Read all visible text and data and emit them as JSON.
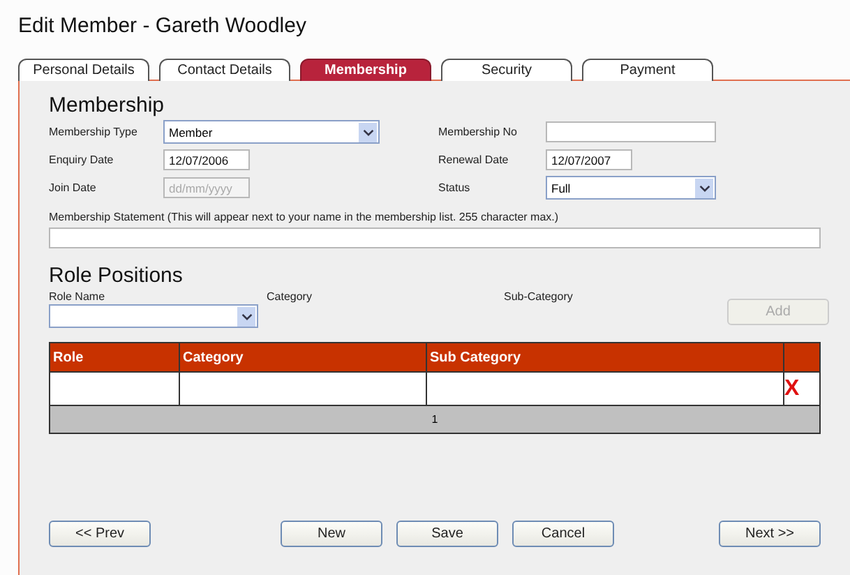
{
  "title": "Edit Member - Gareth Woodley",
  "tabs": [
    {
      "label": "Personal Details",
      "selected": false
    },
    {
      "label": "Contact Details",
      "selected": false
    },
    {
      "label": "Membership",
      "selected": true
    },
    {
      "label": "Security",
      "selected": false
    },
    {
      "label": "Payment",
      "selected": false
    }
  ],
  "membership": {
    "heading": "Membership",
    "membership_type": {
      "label": "Membership Type",
      "value": "Member"
    },
    "membership_no": {
      "label": "Membership No"
    },
    "enquiry_date": {
      "label": "Enquiry Date",
      "value": "12/07/2006"
    },
    "renewal_date": {
      "label": "Renewal Date",
      "value": "12/07/2007"
    },
    "join_date": {
      "label": "Join Date",
      "placeholder": "dd/mm/yyyy"
    },
    "status": {
      "label": "Status",
      "value": "Full"
    },
    "statement": {
      "label": "Membership Statement (This will appear next to your name in the membership list. 255 character max.)"
    }
  },
  "role_positions": {
    "heading": "Role Positions",
    "role_name_label": "Role Name",
    "category_label": "Category",
    "sub_category_label": "Sub-Category",
    "add_button": {
      "label": "Add",
      "disabled": true
    },
    "table": {
      "columns": [
        "Role",
        "Category",
        "Sub Category"
      ],
      "rows": [
        {
          "delete": "X"
        }
      ],
      "pager": "1"
    }
  },
  "buttons": {
    "prev": "<< Prev",
    "actions": [
      "New",
      "Save",
      "Cancel"
    ],
    "next": "Next >>"
  }
}
